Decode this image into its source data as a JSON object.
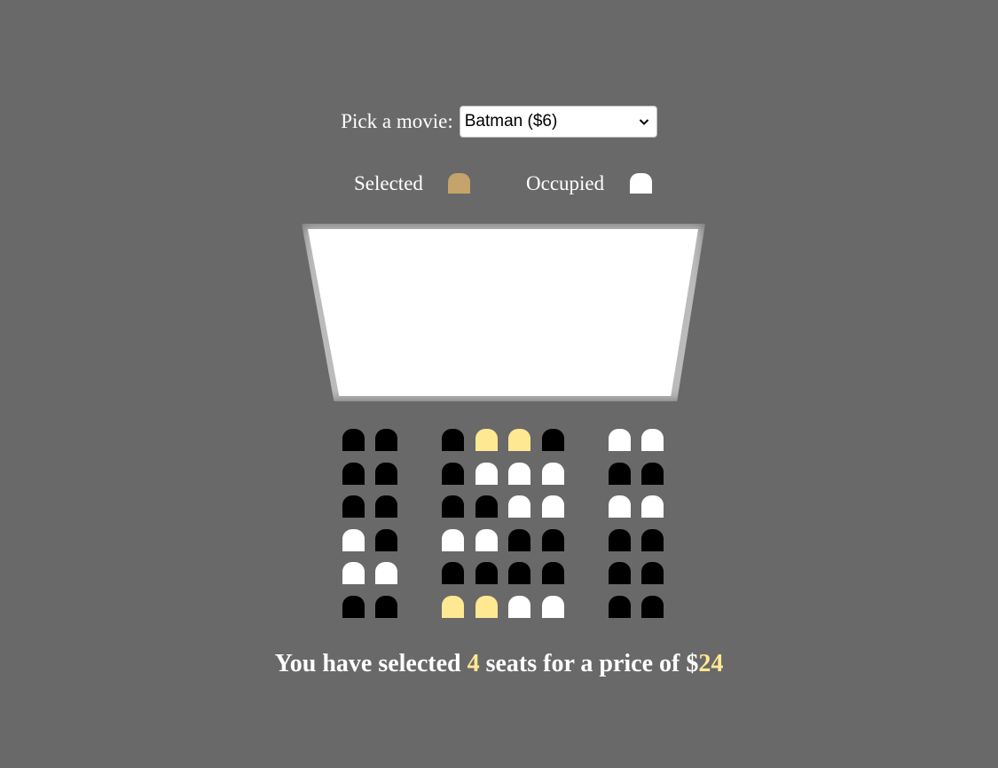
{
  "movie": {
    "label": "Pick a movie:",
    "selected": "Batman ($6)"
  },
  "legend": {
    "selected_label": "Selected",
    "occupied_label": "Occupied"
  },
  "colors": {
    "background": "#696969",
    "seat_available": "#000000",
    "seat_selected": "#ffe892",
    "seat_occupied": "#ffffff",
    "legend_selected": "#c4a46b",
    "accent": "#ffe892"
  },
  "seats": [
    [
      "available",
      "available",
      "available",
      "selected",
      "selected",
      "available",
      "occupied",
      "occupied"
    ],
    [
      "available",
      "available",
      "available",
      "occupied",
      "occupied",
      "occupied",
      "available",
      "available"
    ],
    [
      "available",
      "available",
      "available",
      "available",
      "occupied",
      "occupied",
      "occupied",
      "occupied"
    ],
    [
      "occupied",
      "available",
      "occupied",
      "occupied",
      "available",
      "available",
      "available",
      "available"
    ],
    [
      "occupied",
      "occupied",
      "available",
      "available",
      "available",
      "available",
      "available",
      "available"
    ],
    [
      "available",
      "available",
      "selected",
      "selected",
      "occupied",
      "occupied",
      "available",
      "available"
    ]
  ],
  "summary": {
    "prefix": "You have selected ",
    "count": "4",
    "middle": " seats for a price of $",
    "total": "24"
  }
}
